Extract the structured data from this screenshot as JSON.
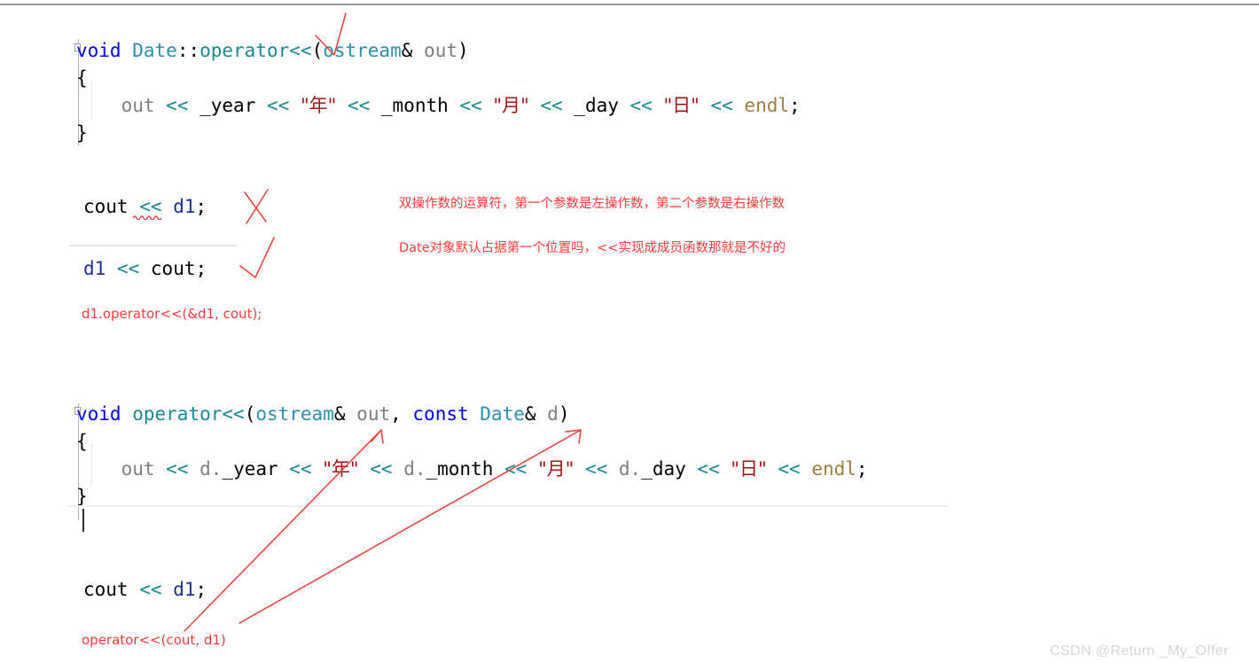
{
  "window": {
    "watermark": "CSDN @Return _My_Offer"
  },
  "code_block_1": {
    "lines": [
      {
        "tokens": [
          {
            "t": "void",
            "c": "kw"
          },
          {
            "t": " ",
            "c": "punct"
          },
          {
            "t": "Date",
            "c": "type"
          },
          {
            "t": "::",
            "c": "punct"
          },
          {
            "t": "operator",
            "c": "fn"
          },
          {
            "t": "<<",
            "c": "op"
          },
          {
            "t": "(",
            "c": "punct"
          },
          {
            "t": "ostream",
            "c": "type"
          },
          {
            "t": "&",
            "c": "punct"
          },
          {
            "t": " ",
            "c": "punct"
          },
          {
            "t": "out",
            "c": "var"
          },
          {
            "t": ")",
            "c": "punct"
          }
        ]
      },
      {
        "tokens": [
          {
            "t": "{",
            "c": "brace"
          }
        ]
      },
      {
        "tokens": [
          {
            "t": "    ",
            "c": "punct"
          },
          {
            "t": "out",
            "c": "var"
          },
          {
            "t": " ",
            "c": "punct"
          },
          {
            "t": "<<",
            "c": "op"
          },
          {
            "t": " ",
            "c": "punct"
          },
          {
            "t": "_year",
            "c": "member"
          },
          {
            "t": " ",
            "c": "punct"
          },
          {
            "t": "<<",
            "c": "op"
          },
          {
            "t": " ",
            "c": "punct"
          },
          {
            "t": "\"年\"",
            "c": "str cjk"
          },
          {
            "t": " ",
            "c": "punct"
          },
          {
            "t": "<<",
            "c": "op"
          },
          {
            "t": " ",
            "c": "punct"
          },
          {
            "t": "_month",
            "c": "member"
          },
          {
            "t": " ",
            "c": "punct"
          },
          {
            "t": "<<",
            "c": "op"
          },
          {
            "t": " ",
            "c": "punct"
          },
          {
            "t": "\"月\"",
            "c": "str cjk"
          },
          {
            "t": " ",
            "c": "punct"
          },
          {
            "t": "<<",
            "c": "op"
          },
          {
            "t": " ",
            "c": "punct"
          },
          {
            "t": "_day",
            "c": "member"
          },
          {
            "t": " ",
            "c": "punct"
          },
          {
            "t": "<<",
            "c": "op"
          },
          {
            "t": " ",
            "c": "punct"
          },
          {
            "t": "\"日\"",
            "c": "str cjk"
          },
          {
            "t": " ",
            "c": "punct"
          },
          {
            "t": "<<",
            "c": "op"
          },
          {
            "t": " ",
            "c": "punct"
          },
          {
            "t": "endl",
            "c": "macro"
          },
          {
            "t": ";",
            "c": "punct"
          }
        ]
      },
      {
        "tokens": [
          {
            "t": "}",
            "c": "brace"
          }
        ]
      }
    ]
  },
  "code_block_2": {
    "lines": [
      {
        "tokens": [
          {
            "t": "void",
            "c": "kw"
          },
          {
            "t": " ",
            "c": "punct"
          },
          {
            "t": "operator",
            "c": "fn"
          },
          {
            "t": "<<",
            "c": "op"
          },
          {
            "t": "(",
            "c": "punct"
          },
          {
            "t": "ostream",
            "c": "type"
          },
          {
            "t": "&",
            "c": "punct"
          },
          {
            "t": " ",
            "c": "punct"
          },
          {
            "t": "out",
            "c": "var"
          },
          {
            "t": ", ",
            "c": "punct"
          },
          {
            "t": "const",
            "c": "kw"
          },
          {
            "t": " ",
            "c": "punct"
          },
          {
            "t": "Date",
            "c": "type"
          },
          {
            "t": "&",
            "c": "punct"
          },
          {
            "t": " ",
            "c": "punct"
          },
          {
            "t": "d",
            "c": "var"
          },
          {
            "t": ")",
            "c": "punct"
          }
        ]
      },
      {
        "tokens": [
          {
            "t": "{",
            "c": "brace"
          }
        ]
      },
      {
        "tokens": [
          {
            "t": "    ",
            "c": "punct"
          },
          {
            "t": "out",
            "c": "var"
          },
          {
            "t": " ",
            "c": "punct"
          },
          {
            "t": "<<",
            "c": "op"
          },
          {
            "t": " ",
            "c": "punct"
          },
          {
            "t": "d.",
            "c": "var"
          },
          {
            "t": "_year",
            "c": "member"
          },
          {
            "t": " ",
            "c": "punct"
          },
          {
            "t": "<<",
            "c": "op"
          },
          {
            "t": " ",
            "c": "punct"
          },
          {
            "t": "\"年\"",
            "c": "str cjk"
          },
          {
            "t": " ",
            "c": "punct"
          },
          {
            "t": "<<",
            "c": "op"
          },
          {
            "t": " ",
            "c": "punct"
          },
          {
            "t": "d.",
            "c": "var"
          },
          {
            "t": "_month",
            "c": "member"
          },
          {
            "t": " ",
            "c": "punct"
          },
          {
            "t": "<<",
            "c": "op"
          },
          {
            "t": " ",
            "c": "punct"
          },
          {
            "t": "\"月\"",
            "c": "str cjk"
          },
          {
            "t": " ",
            "c": "punct"
          },
          {
            "t": "<<",
            "c": "op"
          },
          {
            "t": " ",
            "c": "punct"
          },
          {
            "t": "d.",
            "c": "var"
          },
          {
            "t": "_day",
            "c": "member"
          },
          {
            "t": " ",
            "c": "punct"
          },
          {
            "t": "<<",
            "c": "op"
          },
          {
            "t": " ",
            "c": "punct"
          },
          {
            "t": "\"日\"",
            "c": "str cjk"
          },
          {
            "t": " ",
            "c": "punct"
          },
          {
            "t": "<<",
            "c": "op"
          },
          {
            "t": " ",
            "c": "punct"
          },
          {
            "t": "endl",
            "c": "macro"
          },
          {
            "t": ";",
            "c": "punct"
          }
        ]
      },
      {
        "tokens": [
          {
            "t": "}",
            "c": "brace"
          }
        ]
      }
    ]
  },
  "statements": {
    "cout_d1_top": {
      "tokens": [
        {
          "t": "cout",
          "c": "ident"
        },
        {
          "t": " ",
          "c": "punct"
        },
        {
          "t": "<<",
          "c": "op"
        },
        {
          "t": " ",
          "c": "punct"
        },
        {
          "t": "d1",
          "c": "obj"
        },
        {
          "t": ";",
          "c": "punct"
        }
      ]
    },
    "d1_cout": {
      "tokens": [
        {
          "t": "d1",
          "c": "obj"
        },
        {
          "t": " ",
          "c": "punct"
        },
        {
          "t": "<<",
          "c": "op"
        },
        {
          "t": " ",
          "c": "punct"
        },
        {
          "t": "cout",
          "c": "ident"
        },
        {
          "t": ";",
          "c": "punct"
        }
      ]
    },
    "cout_d1_bottom": {
      "tokens": [
        {
          "t": "cout",
          "c": "ident"
        },
        {
          "t": " ",
          "c": "punct"
        },
        {
          "t": "<<",
          "c": "op"
        },
        {
          "t": " ",
          "c": "punct"
        },
        {
          "t": "d1",
          "c": "obj"
        },
        {
          "t": ";",
          "c": "punct"
        }
      ]
    }
  },
  "annotations": {
    "chinese_line_1": "双操作数的运算符，第一个参数是左操作数，第二个参数是右操作数",
    "chinese_line_2": "Date对象默认占据第一个位置吗，<<实现成成员函数那就是不好的",
    "member_call": "d1.operator<<(&d1, cout);",
    "global_call": "operator<<(cout, d1)",
    "ink_color": "#e8403a",
    "note_color": "#ff3b3b"
  },
  "colors": {
    "keyword": "#0000ff",
    "type": "#2b91af",
    "function": "#1a8a94",
    "operator": "#1a8a94",
    "variable": "#808080",
    "object": "#22308e",
    "string": "#a31515",
    "macro": "#a08040",
    "plain": "#000000",
    "background": "#ffffff",
    "watermark": "#d6d6d6"
  }
}
